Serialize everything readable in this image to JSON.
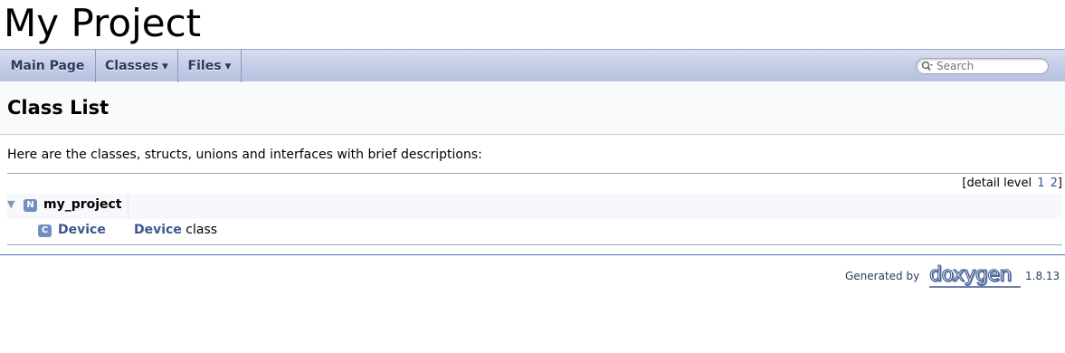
{
  "project": {
    "title": "My Project"
  },
  "nav": {
    "tabs": [
      {
        "label": "Main Page"
      },
      {
        "label": "Classes"
      },
      {
        "label": "Files"
      }
    ],
    "search_placeholder": "Search"
  },
  "page": {
    "title": "Class List",
    "intro": "Here are the classes, structs, unions and interfaces with brief descriptions:",
    "detail_level": {
      "prefix": "[detail level",
      "levels": [
        "1",
        "2"
      ],
      "suffix": "]"
    }
  },
  "class_list": {
    "namespace": {
      "badge": "N",
      "name": "my_project",
      "expand_glyph": "▼"
    },
    "classes": [
      {
        "badge": "C",
        "name": "Device",
        "desc_link": "Device",
        "desc_rest": " class"
      }
    ]
  },
  "footer": {
    "generated_by": "Generated by",
    "logo_text": "doxygen",
    "version": "1.8.13"
  },
  "colors": {
    "link": "#3d578c",
    "badge": "#728dc1",
    "nav_text": "#283a5d"
  }
}
